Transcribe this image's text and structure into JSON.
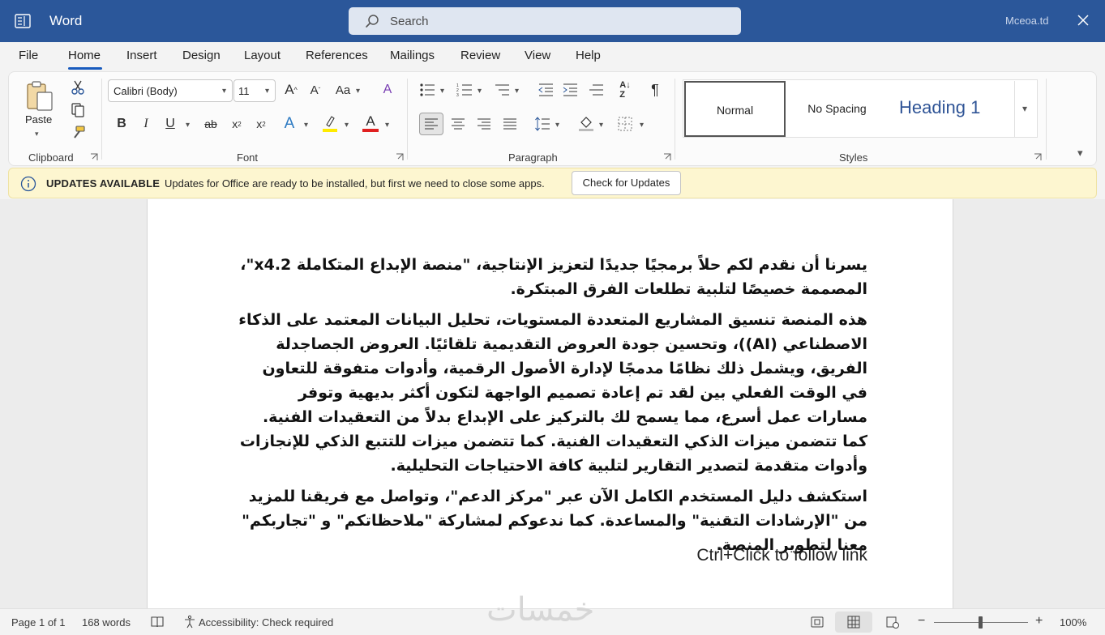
{
  "titlebar": {
    "app_name": "Word",
    "search_placeholder": "Search",
    "account": "Mceoa.td"
  },
  "menu": {
    "tabs": [
      "File",
      "Home",
      "Insert",
      "Design",
      "Layout",
      "References",
      "Mailings",
      "Review",
      "View",
      "Help"
    ],
    "active": "Home"
  },
  "ribbon": {
    "clipboard": {
      "label": "Clipboard",
      "paste_label": "Paste"
    },
    "font": {
      "label": "Font",
      "font_name": "Calibri (Body)",
      "font_size": "11"
    },
    "paragraph": {
      "label": "Paragraph"
    },
    "styles": {
      "label": "Styles",
      "normal": "Normal",
      "no_spacing": "No Spacing",
      "heading1": "Heading 1"
    }
  },
  "update_bar": {
    "title": "UPDATES AVAILABLE",
    "message": "Updates for Office are ready to be installed, but first we need to close some apps.",
    "button": "Check for Updates"
  },
  "document": {
    "paragraphs": [
      "يسرنا أن نقدم لكم حلاً برمجيًا جديدًا لتعزيز الإنتاجية، \"منصة الإبداع المتكاملة x4.2\"، المصممة خصيصًا لتلبية تطلعات الفرق المبتكرة.",
      "هذه المنصة تنسيق المشاريع المتعددة المستويات، تحليل البيانات المعتمد على الذكاء الاصطناعي (AI))، وتحسين جودة العروض التقديمية تلقائيًا. العروض الجصاجدلة الفريق، ويشمل ذلك نظامًا مدمجًا لإدارة الأصول الرقمية، وأدوات متفوقة للتعاون في الوقت الفعلي بين لقد تم إعادة تصميم الواجهة لتكون أكثر بديهية وتوفر مسارات عمل أسرع، مما يسمح لك بالتركيز على الإبداع بدلاً من التعقيدات الفنية. كما تتضمن ميزات الذكي التعقيدات الفنية. كما تتضمن ميزات للتتبع الذكي للإنجازات وأدوات متقدمة لتصدير التقارير لتلبية كافة الاحتياجات التحليلية.",
      "استكشف دليل المستخدم الكامل الآن عبر \"مركز الدعم\"، وتواصل مع فريقنا للمزيد من \"الإرشادات التقنية\" والمساعدة. كما ندعوكم لمشاركة \"ملاحظاتكم\" و \"تجاربكم\" معنا لتطوير المنصة."
    ],
    "link_tooltip": "Ctrl+Click to follow link",
    "watermark": "خمسات"
  },
  "status": {
    "page": "Page 1 of 1",
    "words": "168 words",
    "accessibility": "Accessibility: Check required",
    "zoom": "100%",
    "zoom_minus": "−",
    "zoom_plus": "+"
  }
}
